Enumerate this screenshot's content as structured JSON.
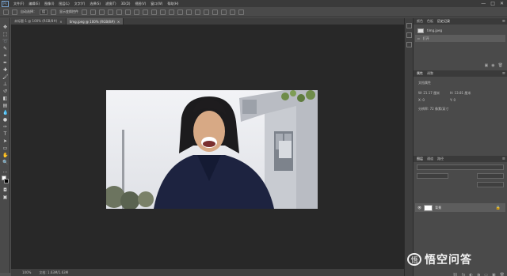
{
  "app": {
    "logo_text": "Ps"
  },
  "menubar": {
    "items": [
      "文件(F)",
      "编辑(E)",
      "图像(I)",
      "图层(L)",
      "文字(Y)",
      "选择(S)",
      "滤镜(T)",
      "3D(D)",
      "视图(V)",
      "窗口(W)",
      "帮助(H)"
    ],
    "window_controls": [
      "—",
      "□",
      "✕"
    ]
  },
  "options_bar": {
    "auto_select_label": "自动选择：",
    "auto_select_value": "组",
    "show_transform_label": "显示变换控件"
  },
  "document_tabs": [
    {
      "label": "未标题-1 @ 100% (RGB/8#)",
      "active": false
    },
    {
      "label": "timg.jpeg @ 100% (RGB/8#)",
      "active": true
    }
  ],
  "statusbar": {
    "zoom": "100%",
    "doc_info": "文档: 1.63M/1.63M"
  },
  "panels": {
    "history": {
      "tabs": [
        "颜色",
        "色板",
        "历史记录"
      ],
      "active_tab": "历史记录",
      "snapshot_label": "timg.jpeg",
      "state_label": "打开"
    },
    "properties": {
      "tabs": [
        "属性",
        "调整"
      ],
      "active_tab": "属性",
      "title": "文档属性",
      "lines": [
        "W: 21.17 厘米",
        "H: 13.81 厘米",
        "X: 0",
        "Y: 0",
        "分辨率: 72 像素/英寸"
      ]
    },
    "layers": {
      "tabs": [
        "图层",
        "通道",
        "路径"
      ],
      "active_tab": "图层",
      "layer_name": "背景"
    }
  },
  "watermark": {
    "logo_glyph": "悟",
    "text": "悟空问答"
  }
}
